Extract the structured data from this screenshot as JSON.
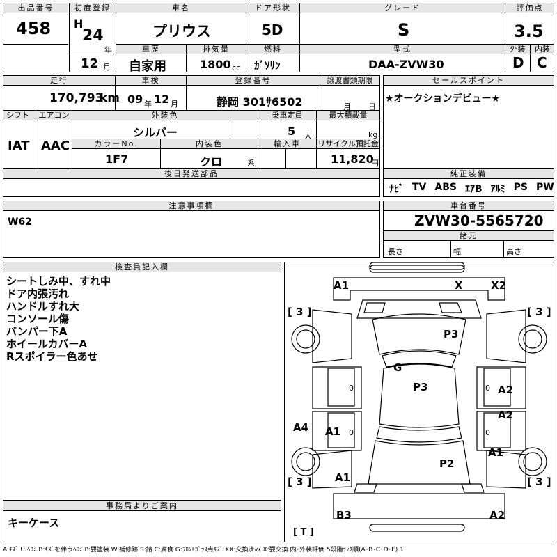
{
  "lot": {
    "label": "出品番号",
    "value": "458"
  },
  "first_reg": {
    "label": "初度登録",
    "era": "H",
    "year": "24",
    "year_unit": "年",
    "month": "12",
    "month_unit": "月"
  },
  "car_name": {
    "label": "車名",
    "value": "プリウス"
  },
  "door": {
    "label": "ドア形状",
    "value": "5D"
  },
  "grade": {
    "label": "グレード",
    "value": "S"
  },
  "score": {
    "label": "評価点",
    "value": "3.5",
    "ext_label": "外装",
    "int_label": "内装",
    "ext": "D",
    "int": "C"
  },
  "history": {
    "label": "車歴",
    "value": "自家用"
  },
  "displacement": {
    "label": "排気量",
    "value": "1800",
    "unit": "cc"
  },
  "fuel": {
    "label": "燃料",
    "value": "ｶﾞｿﾘﾝ"
  },
  "model": {
    "label": "型式",
    "value": "DAA-ZVW30"
  },
  "mileage": {
    "label": "走行",
    "value": "170,793",
    "unit": "km"
  },
  "inspection": {
    "label": "車検",
    "year": "09",
    "year_unit": "年",
    "month": "12",
    "month_unit": "月"
  },
  "plate": {
    "label": "登録番号",
    "value": "静岡 301ｻ6502"
  },
  "transfer": {
    "label": "譲渡書類期限",
    "month_unit": "月",
    "day_unit": "日"
  },
  "sales_point": {
    "label": "セールスポイント",
    "value": "★オークションデビュー★"
  },
  "shift": {
    "label": "シフト",
    "value": "IAT"
  },
  "aircon": {
    "label": "エアコン",
    "value": "AAC"
  },
  "ext_color": {
    "label": "外装色",
    "value": "シルバー"
  },
  "capacity": {
    "label": "乗車定員",
    "value": "5",
    "unit": "人"
  },
  "max_load": {
    "label": "最大積載量",
    "unit": "kg"
  },
  "color_no": {
    "label": "カラーNo.",
    "value": "1F7"
  },
  "int_color": {
    "label": "内装色",
    "value": "クロ",
    "unit": "系"
  },
  "import": {
    "label": "輸入車"
  },
  "recycle": {
    "label": "リサイクル預託金",
    "value": "11,820",
    "unit": "円"
  },
  "later_parts": {
    "label": "後日発送部品"
  },
  "genuine": {
    "label": "純正装備",
    "items": [
      "ﾅﾋﾞ",
      "TV",
      "ABS",
      "ｴｱB",
      "ｱﾙﾐ",
      "PS",
      "PW"
    ]
  },
  "notice": {
    "label": "注意事項欄",
    "value": "W62"
  },
  "chassis": {
    "label": "車台番号",
    "value": "ZVW30-5565720"
  },
  "dims": {
    "label": "諸元",
    "length": "長さ",
    "width": "幅",
    "height": "高さ"
  },
  "inspector": {
    "label": "検査員記入欄",
    "lines": [
      "シートしみ中、すれ中",
      "ドア内張汚れ",
      "ハンドルすれ大",
      "コンソール傷",
      "バンパー下A",
      "ホイールカバーA",
      "Rスポイラー色あせ"
    ]
  },
  "office": {
    "label": "事務局よりご案内",
    "value": "キーケース"
  },
  "diagram": {
    "marks": {
      "a1_top": "A1",
      "x": "X",
      "x2": "X2",
      "p3_a": "P3",
      "g": "G",
      "p3_b": "P3",
      "a2_a": "A2",
      "a2_b": "A2",
      "a4": "A4",
      "a1_mid": "A1",
      "a1_right": "A1",
      "p2": "P2",
      "a1_low": "A1",
      "b3": "B3",
      "a2_c": "A2",
      "t": "[ T ]"
    },
    "brackets": {
      "tl": "[ 3 ]",
      "tr": "[ 3 ]",
      "bl": "[ 3 ]",
      "br": "[ 3 ]"
    },
    "zeros": {
      "l1": "0",
      "r1": "0",
      "l2": "0",
      "r2": "0"
    }
  },
  "legend": "A:ｷｽﾞ  U:ﾍｺﾐ  B:ｷｽﾞを伴うﾍｺﾐ  P:要塗装  W:補修跡  S:錆  C:腐食  G:ﾌﾛﾝﾄｶﾞﾗｽ点ｷｽﾞ  XX:交換済み  X:要交換   内･外装評価  5段階ﾗﾝｸ順(A･B･C･D･E) 1"
}
